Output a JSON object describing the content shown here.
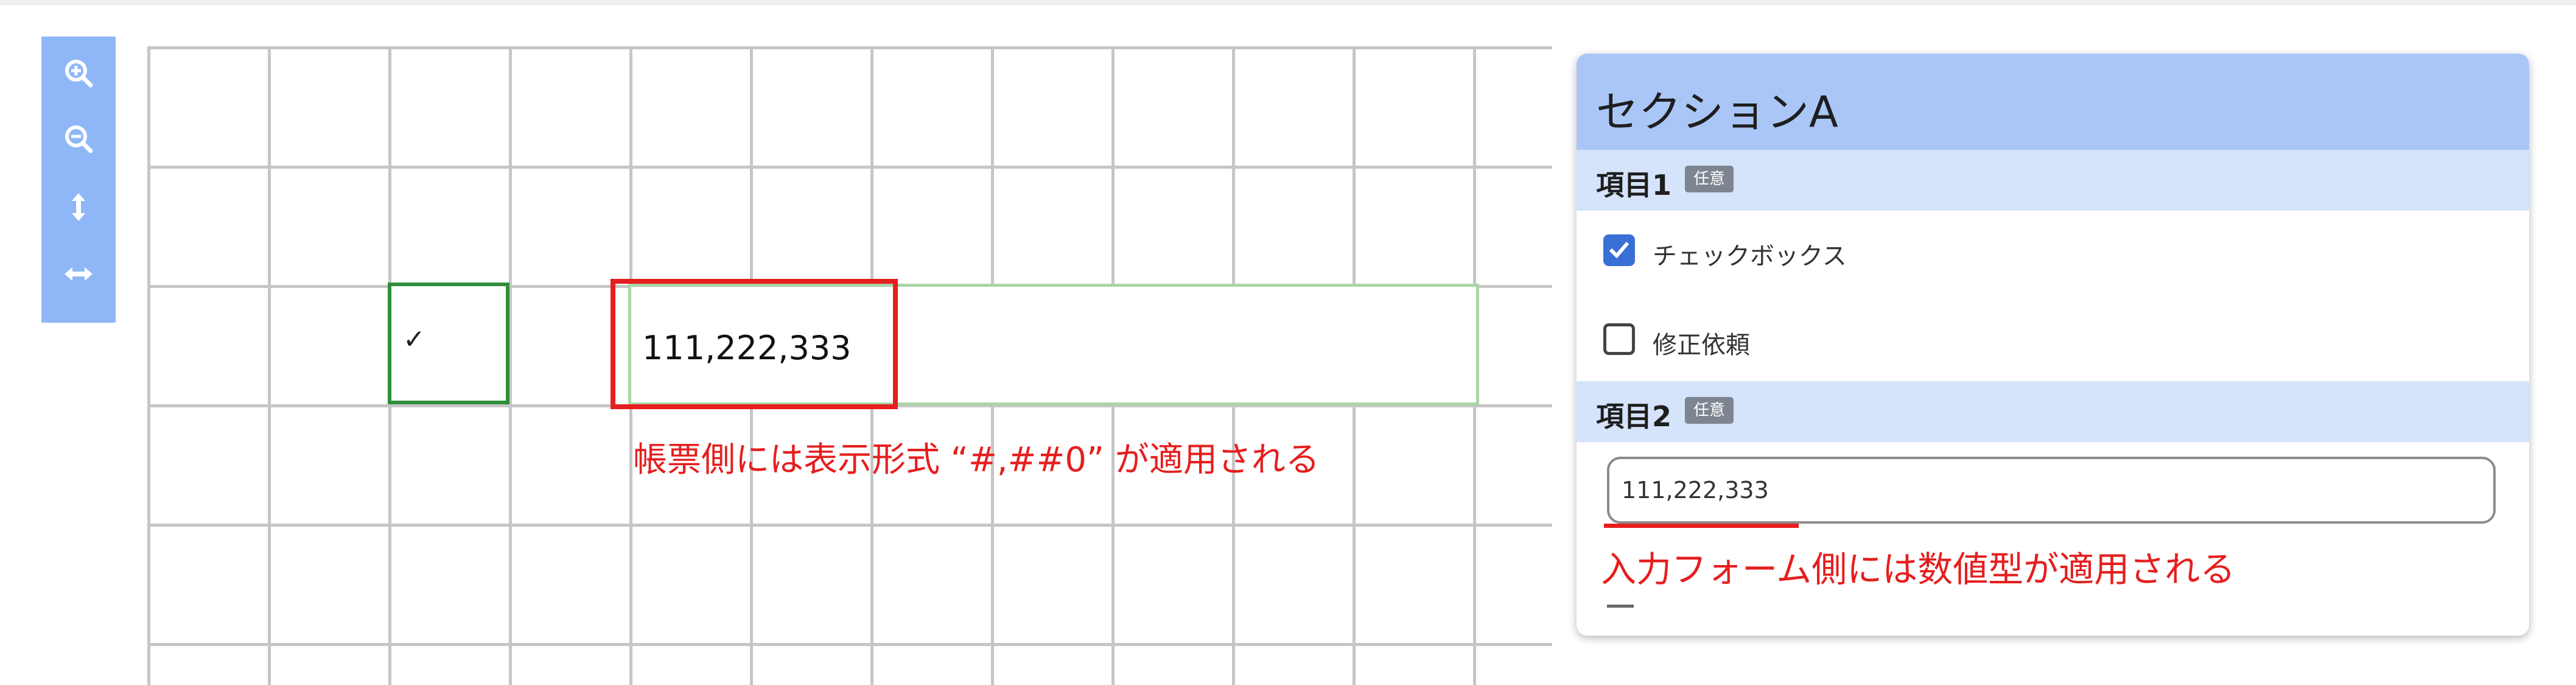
{
  "toolbar": {
    "buttons": [
      {
        "icon": "zoom-in-icon"
      },
      {
        "icon": "zoom-out-icon"
      },
      {
        "icon": "fit-height-icon"
      },
      {
        "icon": "fit-width-icon"
      }
    ]
  },
  "sheet": {
    "checkbox_cell_value": "✓",
    "number_cell_value": "111,222,333",
    "annotation": "帳票側には表示形式 “#,##0” が適用される"
  },
  "form": {
    "section_title": "セクションA",
    "item1": {
      "label": "項目1",
      "badge": "任意",
      "options": [
        {
          "label": "チェックボックス",
          "checked": true
        },
        {
          "label": "修正依頼",
          "checked": false
        }
      ]
    },
    "item2": {
      "label": "項目2",
      "badge": "任意",
      "value": "111,222,333"
    },
    "annotation": "入力フォーム側には数値型が適用される"
  },
  "colors": {
    "toolbar": "#8fb7f7",
    "section_header": "#a9c6f7",
    "item_header": "#d5e3fb",
    "annotation_red": "#e61e1e",
    "checkbox_cell_border": "#2f8e3a",
    "checkbox_checked": "#3a6fd6"
  }
}
